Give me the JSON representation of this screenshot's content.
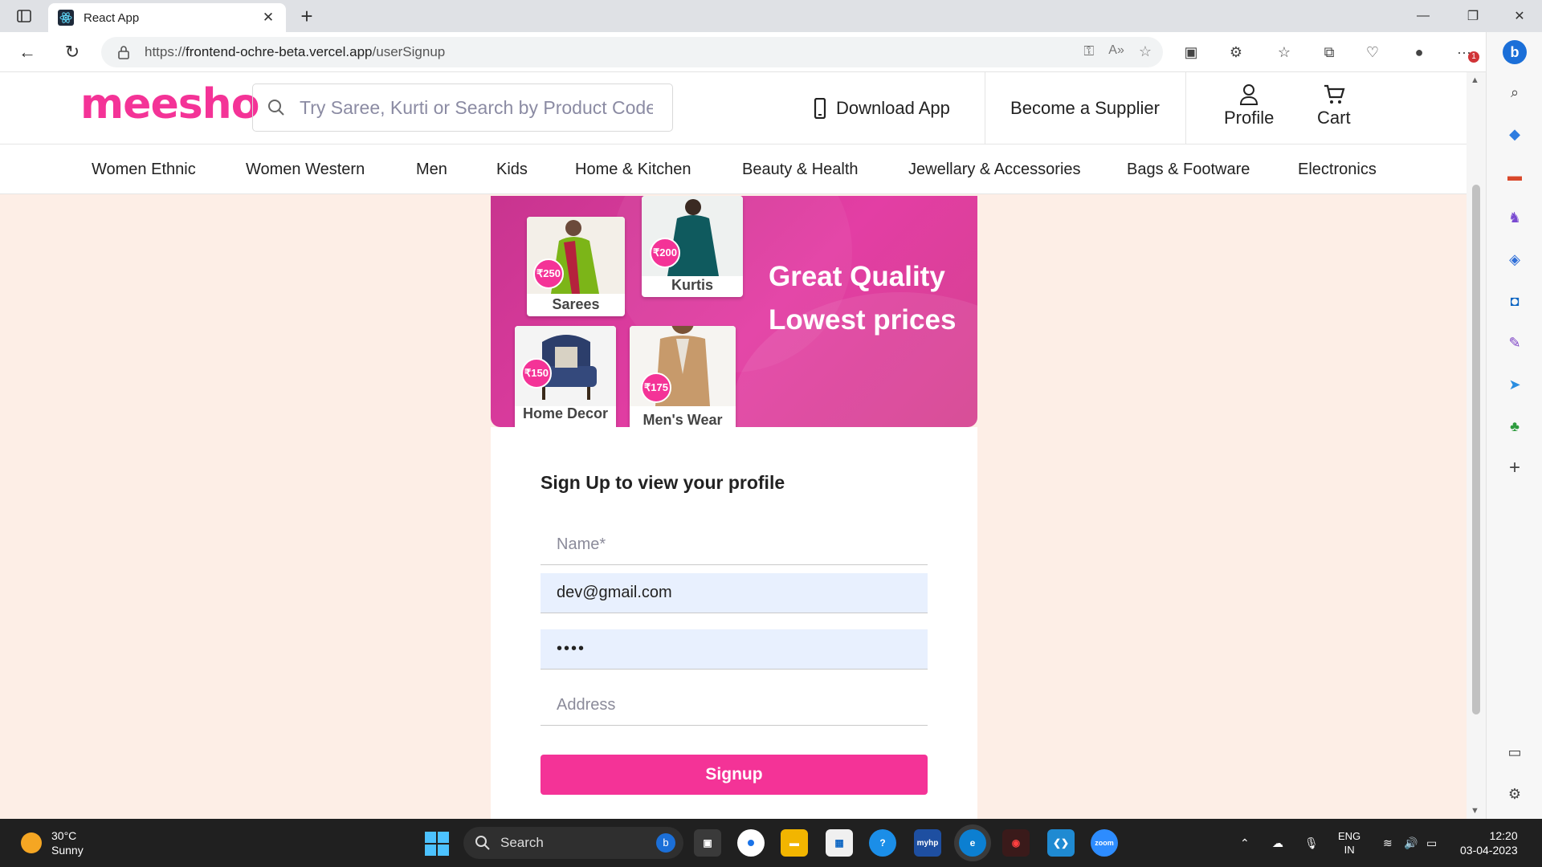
{
  "browser": {
    "tab_title": "React App",
    "url_prefix": "https://",
    "url_host": "frontend-ochre-beta.vercel.app",
    "url_path": "/userSignup",
    "notification_count": "1"
  },
  "header": {
    "logo": "meesho",
    "search_placeholder": "Try Saree, Kurti or Search by Product Code",
    "download_app": "Download App",
    "become_supplier": "Become a Supplier",
    "profile": "Profile",
    "cart": "Cart"
  },
  "categories": [
    "Women Ethnic",
    "Women Western",
    "Men",
    "Kids",
    "Home & Kitchen",
    "Beauty & Health",
    "Jewellary & Accessories",
    "Bags & Footware",
    "Electronics"
  ],
  "banner": {
    "tagline_line1": "Great Quality",
    "tagline_line2": "Lowest prices",
    "products": [
      {
        "label": "Sarees",
        "price": "₹250"
      },
      {
        "label": "Kurtis",
        "price": "₹200"
      },
      {
        "label": "Home Decor",
        "price": "₹150"
      },
      {
        "label": "Men's Wear",
        "price": "₹175"
      }
    ]
  },
  "form": {
    "title": "Sign Up to view your profile",
    "name_placeholder": "Name*",
    "email_value": "dev@gmail.com",
    "password_value": "••••",
    "address_placeholder": "Address",
    "signup_label": "Signup"
  },
  "taskbar": {
    "temperature": "30°C",
    "weather": "Sunny",
    "search_label": "Search",
    "lang_line1": "ENG",
    "lang_line2": "IN",
    "time": "12:20",
    "date": "03-04-2023"
  },
  "colors": {
    "brand": "#f43397",
    "page_background": "#fdeee6",
    "autofill": "#e8f0fe"
  }
}
